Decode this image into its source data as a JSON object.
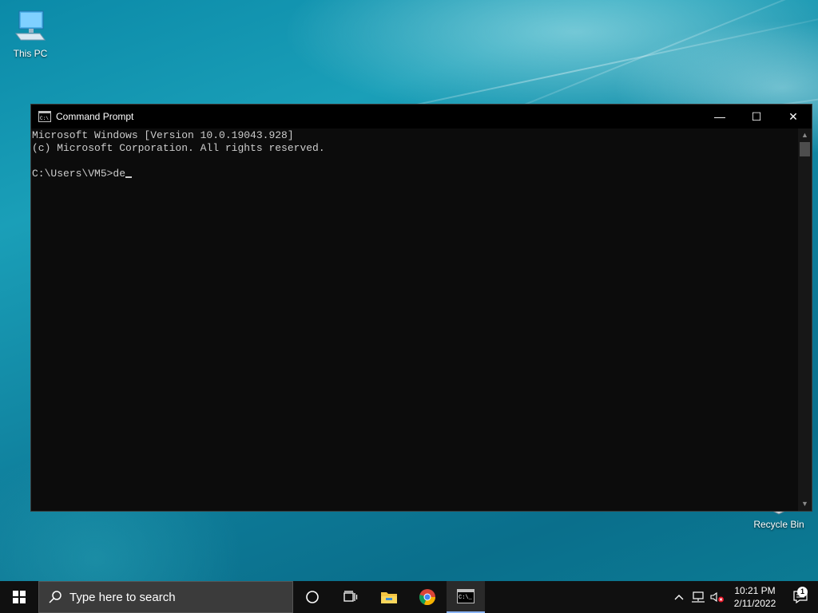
{
  "desktop": {
    "icons": [
      {
        "label": "This PC",
        "icon": "computer-icon"
      },
      {
        "label": "Recycle Bin",
        "icon": "recycle-bin-icon"
      }
    ]
  },
  "window": {
    "title": "Command Prompt",
    "icon": "cmd-icon",
    "controls": {
      "minimize": "—",
      "maximize": "☐",
      "close": "✕"
    },
    "console": {
      "line1": "Microsoft Windows [Version 10.0.19043.928]",
      "line2": "(c) Microsoft Corporation. All rights reserved.",
      "prompt": "C:\\Users\\VM5>",
      "input": "de"
    }
  },
  "taskbar": {
    "search_placeholder": "Type here to search",
    "apps": [
      "start-icon",
      "cortana-icon",
      "task-view-icon",
      "file-explorer-icon",
      "chrome-icon",
      "cmd-icon"
    ],
    "tray": {
      "time": "10:21 PM",
      "date": "2/11/2022",
      "notification_count": "1"
    }
  },
  "colors": {
    "console_bg": "#0c0c0c",
    "console_text": "#cccccc",
    "taskbar_bg": "#101010"
  }
}
